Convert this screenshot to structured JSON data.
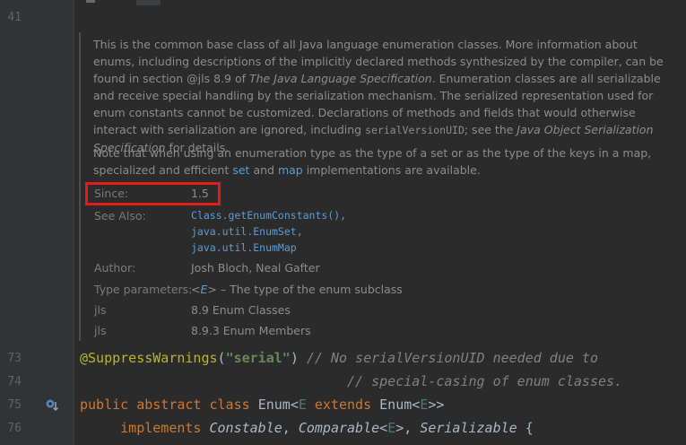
{
  "line_numbers": [
    "41",
    "73",
    "74",
    "75",
    "76"
  ],
  "doc": {
    "p1": {
      "a": "This is the common base class of all Java language enumeration classes. More information about enums, including descriptions of the implicitly declared methods synthesized by the compiler, can be found in section @jls 8.9 of ",
      "b": "The Java Language Specification",
      "c": ". Enumeration classes are all serializable and receive special handling by the serialization mechanism. The serialized representation used for enum constants cannot be customized. Declarations of methods and fields that would otherwise interact with serialization are ignored, including ",
      "d": "serialVersionUID",
      "e": "; see the ",
      "f": "Java Object Serialization Specification",
      "g": " for details."
    },
    "p2": {
      "a": "Note that when using an enumeration type as the type of a set or as the type of the keys in a map, specialized and efficient ",
      "set": "set",
      "b": " and ",
      "map": "map",
      "c": " implementations are available."
    },
    "since": {
      "label": "Since:",
      "value": "1.5"
    },
    "see_also": {
      "label": "See Also:",
      "links": [
        "Class.getEnumConstants()",
        "java.util.EnumSet",
        "java.util.EnumMap"
      ],
      "comma": ","
    },
    "author": {
      "label": "Author:",
      "value": "Josh Bloch, Neal Gafter"
    },
    "type_params": {
      "label": "Type parameters:",
      "lt": "<",
      "name": "E",
      "gt": ">",
      "rest": " – The type of the enum subclass"
    },
    "jls1": {
      "label": "jls",
      "value": "8.9 Enum Classes"
    },
    "jls2": {
      "label": "jls",
      "value": "8.9.3 Enum Members"
    }
  },
  "code": {
    "l73": {
      "annotation": "@SuppressWarnings",
      "open": "(",
      "string": "\"serial\"",
      "close": ")",
      "comment": " // No serialVersionUID needed due to"
    },
    "l74": {
      "comment": "                                 // special-casing of enum classes."
    },
    "l75": {
      "public": "public",
      "abstract": "abstract",
      "class": "class",
      "name": "Enum",
      "lt": "<",
      "tp": "E",
      "extends": "extends",
      "enum2": "Enum",
      "lt2": "<",
      "tp2": "E",
      "gt": ">>"
    },
    "l76": {
      "implements": "implements",
      "t1": "Constable",
      "comma1": ", ",
      "t2": "Comparable",
      "lt": "<",
      "tp": "E",
      "gt": ">",
      "comma2": ", ",
      "t3": "Serializable",
      "brace": " {"
    }
  },
  "icons": {
    "gutter_marker": "overrides-marker-icon"
  }
}
